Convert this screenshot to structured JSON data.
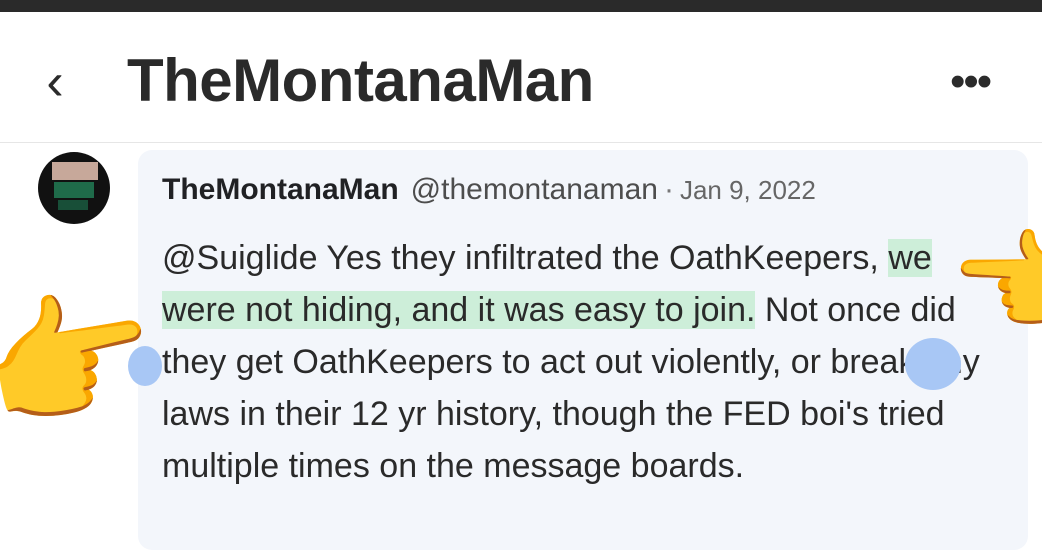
{
  "header": {
    "back_icon": "chevron-left-icon",
    "back_glyph": "‹",
    "title": "TheMontanaMan",
    "more_icon": "more-horizontal-icon",
    "more_glyph": "•••"
  },
  "post": {
    "display_name": "TheMontanaMan",
    "handle": "@themontanaman",
    "separator": "·",
    "date": "Jan 9, 2022",
    "text_before": "@Suiglide Yes they infiltrated the OathKeepers, ",
    "text_highlight": "we were not hiding, and it was easy to join.",
    "text_after": " Not once did they get OathKeepers to act out violently, or break any laws in their 12 yr history, though the FED boi's tried multiple times on the message boards."
  },
  "overlay": {
    "hand_left_icon": "pointing-hand-emoji",
    "hand_right_icon": "pointing-hand-emoji",
    "hand_glyph": "👉",
    "highlight_color": "#cdeed9",
    "blob_color": "#a8c7f5"
  }
}
